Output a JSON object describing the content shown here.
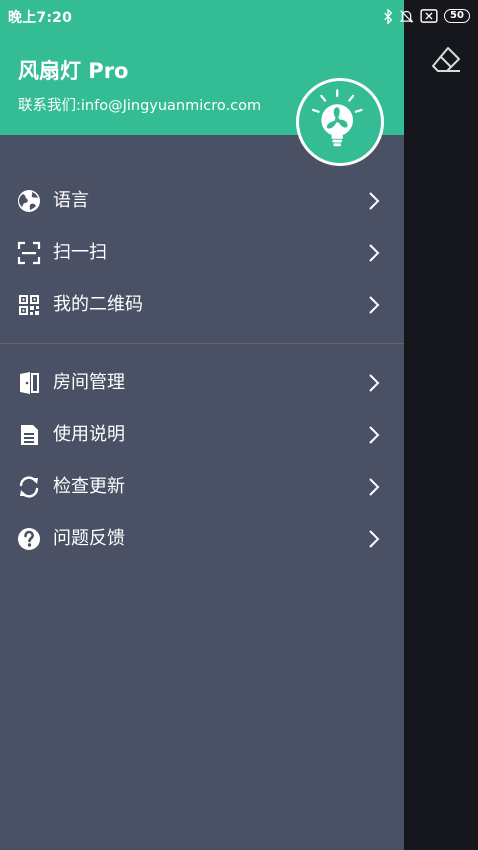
{
  "status_bar": {
    "time": "晚上7:20",
    "battery": "50",
    "icons": [
      "bluetooth-icon",
      "bell-off-icon",
      "sim-x-icon",
      "battery-icon"
    ]
  },
  "header": {
    "title": "风扇灯 Pro",
    "contact": "联系我们:info@Jingyuanmicro.com",
    "avatar_icon": "fan-bulb-icon"
  },
  "menu_group_1": [
    {
      "label": "语言",
      "icon": "globe-icon"
    },
    {
      "label": "扫一扫",
      "icon": "scan-icon"
    },
    {
      "label": "我的二维码",
      "icon": "qr-code-icon"
    }
  ],
  "menu_group_2": [
    {
      "label": "房间管理",
      "icon": "door-icon"
    },
    {
      "label": "使用说明",
      "icon": "document-icon"
    },
    {
      "label": "检查更新",
      "icon": "refresh-icon"
    },
    {
      "label": "问题反馈",
      "icon": "help-icon"
    }
  ],
  "colors": {
    "header_bg": "#34bc94",
    "drawer_bg": "#4b5164",
    "backdrop": "#15171c",
    "text": "#ffffff"
  }
}
